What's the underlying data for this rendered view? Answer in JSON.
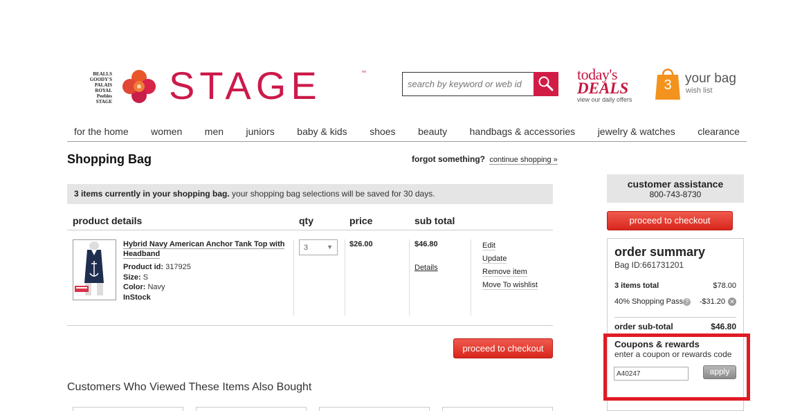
{
  "header": {
    "brands": [
      "BEALLS",
      "GOODY'S",
      "PALAIS ROYAL",
      "Peebles",
      "STAGE"
    ],
    "logo": "STAGE",
    "logo_tm": "™",
    "search_placeholder": "search by keyword or web id",
    "deals_top": "today's",
    "deals_big": "DEALS",
    "deals_sub": "view our daily offers",
    "bag_count": "3",
    "bag_title": "your bag",
    "wishlist": "wish list",
    "accent_color": "#cc1a4a"
  },
  "nav": [
    "for the home",
    "women",
    "men",
    "juniors",
    "baby & kids",
    "shoes",
    "beauty",
    "handbags & accessories",
    "jewelry & watches",
    "clearance"
  ],
  "main": {
    "title": "Shopping Bag",
    "forgot": "forgot something?",
    "continue": "continue shopping »",
    "note_bold": "3 items currently in your shopping bag.",
    "note_rest": " your shopping bag selections will be saved for 30 days.",
    "columns": [
      "product details",
      "qty",
      "price",
      "sub total"
    ],
    "item": {
      "name": "Hybrid Navy American Anchor Tank Top with Headband",
      "product_id_label": "Product id:",
      "product_id": "317925",
      "size_label": "Size:",
      "size": "S",
      "color_label": "Color:",
      "color": "Navy",
      "stock": "InStock",
      "qty": "3",
      "price": "$26.00",
      "subtotal": "$46.80",
      "details": "Details",
      "actions": [
        "Edit",
        "Update",
        "Remove item",
        "Move To wishlist"
      ]
    },
    "checkout": "proceed to checkout",
    "also_bought": "Customers Who Viewed These Items Also Bought"
  },
  "sidebar": {
    "assist_title": "customer assistance",
    "assist_phone": "800-743-8730",
    "checkout": "proceed to checkout",
    "summary_title": "order summary",
    "bag_id": "Bag ID:661731201",
    "items_label": "3  items total",
    "items_value": "$78.00",
    "pass_label": "40% Shopping Pass",
    "pass_value": "-$31.20",
    "subtotal_label": "order sub-total",
    "subtotal_value": "$46.80",
    "coupon_title": "Coupons & rewards",
    "coupon_sub": "enter a coupon or rewards code",
    "coupon_value": "A40247",
    "apply": "apply",
    "highlight_color": "#e01b24"
  }
}
